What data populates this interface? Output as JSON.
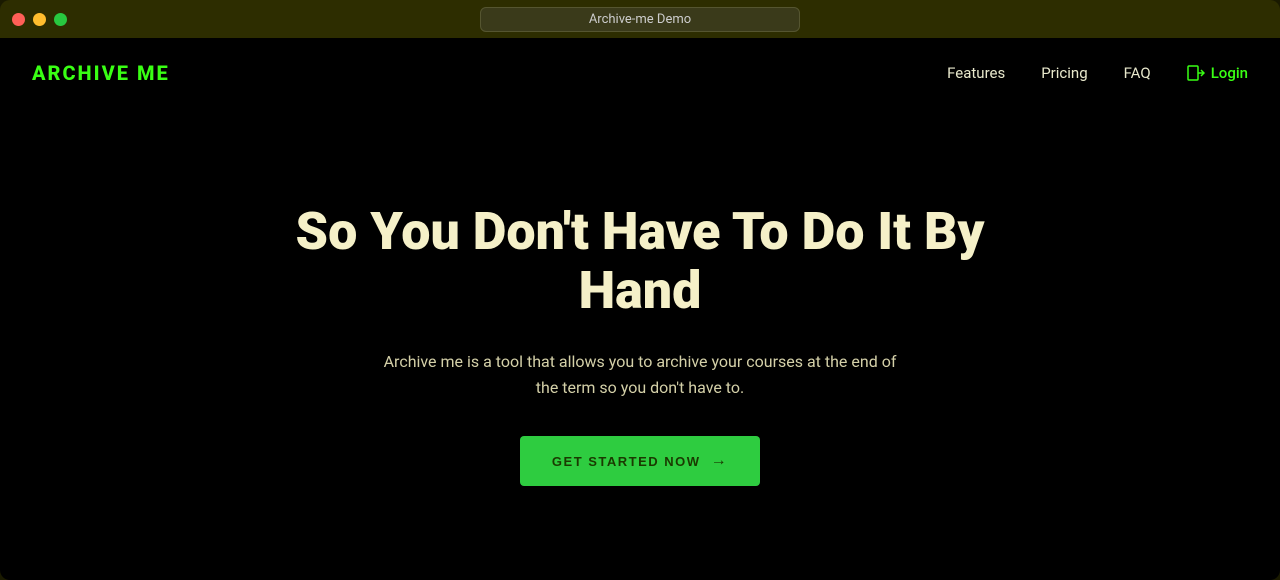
{
  "window": {
    "title_bar": {
      "address_bar_text": "Archive-me Demo"
    }
  },
  "nav": {
    "logo": "ARCHIVE ME",
    "links": [
      {
        "label": "Features",
        "id": "features"
      },
      {
        "label": "Pricing",
        "id": "pricing"
      },
      {
        "label": "FAQ",
        "id": "faq"
      }
    ],
    "login_label": "Login"
  },
  "hero": {
    "title": "So You Don't Have To Do It By Hand",
    "subtitle": "Archive me is a tool that allows you to archive your courses at the end of the term so you don't have to.",
    "cta_label": "GET STARTED NOW",
    "cta_arrow": "→"
  },
  "colors": {
    "brand_green": "#39ff14",
    "cta_green": "#2ecc40",
    "background": "#000000",
    "title_bar_bg": "#2d2d00",
    "text_primary": "#f5f0c8",
    "text_secondary": "#d4d0a8"
  }
}
